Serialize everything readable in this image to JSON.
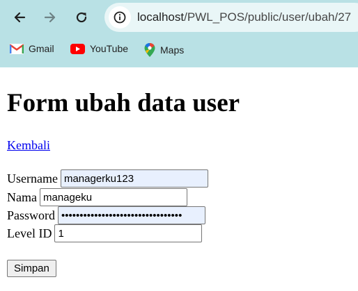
{
  "browser": {
    "url_host": "localhost",
    "url_path": "/PWL_POS/public/user/ubah/27",
    "bookmarks": [
      {
        "label": "Gmail",
        "icon": "gmail-icon"
      },
      {
        "label": "YouTube",
        "icon": "youtube-icon"
      },
      {
        "label": "Maps",
        "icon": "maps-icon"
      }
    ]
  },
  "page": {
    "title": "Form ubah data user",
    "back_link": "Kembali",
    "fields": [
      {
        "label": "Username",
        "value": "managerku123"
      },
      {
        "label": "Nama",
        "value": "manageku"
      },
      {
        "label": "Password",
        "value": "managerku123managerku123managerku"
      },
      {
        "label": "Level ID",
        "value": "1"
      }
    ],
    "submit_label": "Simpan"
  },
  "colors": {
    "chrome_background": "#b9e1e5",
    "link": "#0000ee",
    "autofill_background": "#e8f0fe"
  }
}
